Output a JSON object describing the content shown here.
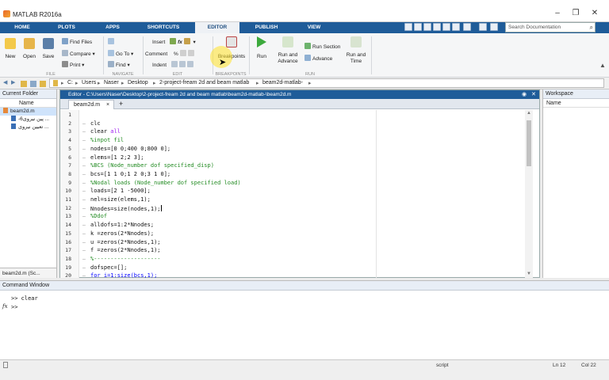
{
  "window": {
    "title": "MATLAB R2016a"
  },
  "tabs": [
    "HOME",
    "PLOTS",
    "APPS",
    "SHORTCUTS",
    "EDITOR",
    "PUBLISH",
    "VIEW"
  ],
  "active_tab": "EDITOR",
  "search": {
    "placeholder": "Search Documentation"
  },
  "toolstrip": {
    "file": {
      "new": "New",
      "open": "Open",
      "save": "Save",
      "find_files": "Find Files",
      "compare": "Compare",
      "print": "Print",
      "group": "FILE"
    },
    "navigate": {
      "goto": "Go To",
      "find": "Find",
      "group": "NAVIGATE"
    },
    "edit": {
      "insert": "Insert",
      "comment": "Comment",
      "indent": "Indent",
      "group": "EDIT"
    },
    "breakpoints": {
      "label": "Breakpoints",
      "group": "BREAKPOINTS"
    },
    "run": {
      "run": "Run",
      "run_advance_1": "Run and",
      "run_advance_2": "Advance",
      "run_section": "Run Section",
      "advance": "Advance",
      "run_time_1": "Run and",
      "run_time_2": "Time",
      "group": "RUN"
    }
  },
  "address": {
    "crumbs": [
      "C:",
      "Users",
      "Naser",
      "Desktop",
      "2-project-fream 2d and beam matlab",
      "beam2d-matlab-"
    ]
  },
  "current_folder": {
    "title": "Current Folder",
    "col": "Name",
    "files": [
      "beam2d.m",
      "-6پین نیروی ...",
      "تعیین نیروی ..."
    ],
    "status": "beam2d.m (Sc..."
  },
  "editor": {
    "title": "Editor - C:\\Users\\Naser\\Desktop\\2-project-fream 2d and beam matlab\\beam2d-matlab-\\beam2d.m",
    "tab": "beam2d.m",
    "lines": [
      {
        "n": "1",
        "t": "",
        "c": ""
      },
      {
        "n": "2",
        "t": "clc",
        "c": ""
      },
      {
        "n": "3",
        "t": "clear all",
        "c": ""
      },
      {
        "n": "4",
        "t": "%inpot fil",
        "c": "cm"
      },
      {
        "n": "5",
        "t": "nodes=[0 0;400 0;800 0];",
        "c": ""
      },
      {
        "n": "6",
        "t": "elems=[1 2;2 3];",
        "c": ""
      },
      {
        "n": "7",
        "t": "%BCS (Node_number dof specified_disp)",
        "c": "cm"
      },
      {
        "n": "8",
        "t": "bcs=[1 1 0;1 2 0;3 1 0];",
        "c": ""
      },
      {
        "n": "9",
        "t": "%Nodal loads (Node_number dof specified load)",
        "c": "cm"
      },
      {
        "n": "10",
        "t": "loads=[2 1 -5000];",
        "c": ""
      },
      {
        "n": "11",
        "t": "nel=size(elems,1);",
        "c": ""
      },
      {
        "n": "12",
        "t": "Nnodes=size(nodes,1);",
        "c": ""
      },
      {
        "n": "13",
        "t": "%Ddof",
        "c": "cm"
      },
      {
        "n": "14",
        "t": "alldofs=1:2*Nnodes;",
        "c": ""
      },
      {
        "n": "15",
        "t": "k =zeros(2*Nnodes);",
        "c": ""
      },
      {
        "n": "16",
        "t": "u =zeros(2*Nnodes,1);",
        "c": ""
      },
      {
        "n": "17",
        "t": "f =zeros(2*Nnodes,1);",
        "c": ""
      },
      {
        "n": "18",
        "t": "%--------------------",
        "c": "cm"
      },
      {
        "n": "19",
        "t": "dofspec=[];",
        "c": ""
      },
      {
        "n": "20",
        "t": "for i=1:size(bcs,1);",
        "c": "kw"
      }
    ]
  },
  "workspace": {
    "title": "Workspace",
    "col": "Name"
  },
  "command_window": {
    "title": "Command Window",
    "line1": ">> clear",
    "prompt": ">>"
  },
  "status": {
    "mode": "script",
    "ln": "Ln  12",
    "col": "Col  22"
  }
}
